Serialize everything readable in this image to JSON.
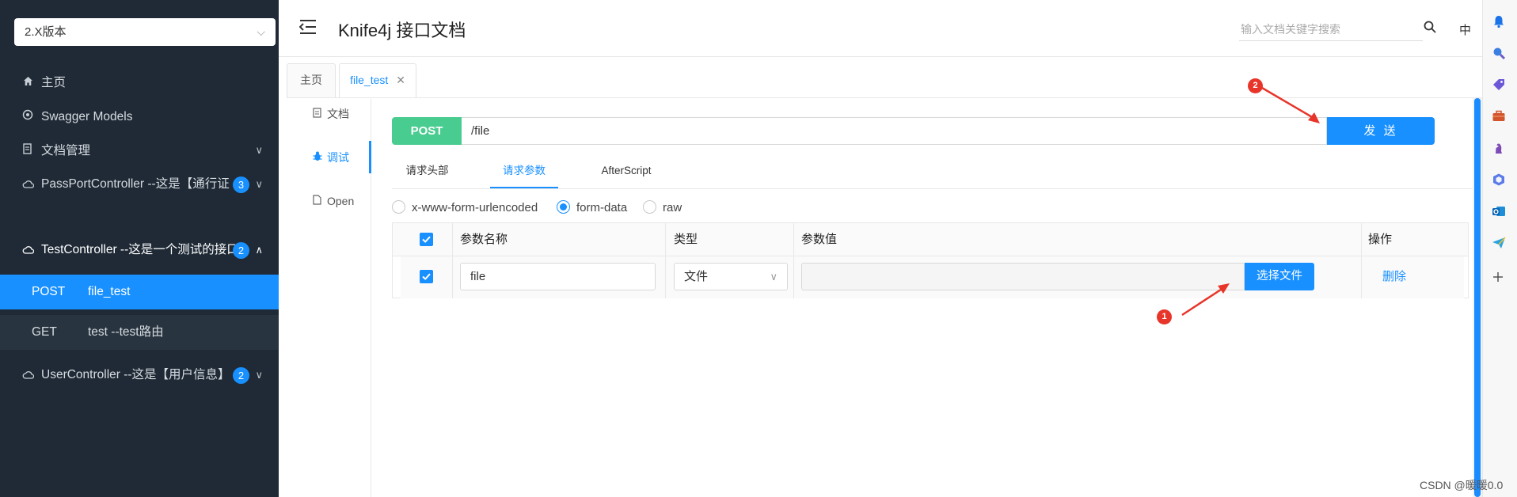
{
  "sidebar": {
    "version_select": "2.X版本",
    "items": [
      {
        "label": "主页",
        "icon": "home-icon"
      },
      {
        "label": "Swagger Models",
        "icon": "model-icon"
      },
      {
        "label": "文档管理",
        "icon": "doc-manage-icon"
      },
      {
        "label": "PassPortController --这是【通行证",
        "badge": "3",
        "icon": "cloud-icon"
      },
      {
        "label": "TestController --这是一个测试的接口",
        "badge": "2",
        "icon": "cloud-icon"
      },
      {
        "label": "UserController --这是【用户信息】",
        "badge": "2",
        "icon": "cloud-icon"
      }
    ],
    "sub_items": [
      {
        "method": "POST",
        "name": "file_test"
      },
      {
        "method": "GET",
        "name": "test --test路由"
      }
    ]
  },
  "header": {
    "title": "Knife4j 接口文档",
    "search_placeholder": "输入文档关键字搜索",
    "lang": "中"
  },
  "tabs": [
    {
      "label": "主页"
    },
    {
      "label": "file_test",
      "close": "✕"
    }
  ],
  "vnav": [
    {
      "label": "文档"
    },
    {
      "label": "调试"
    },
    {
      "label": "Open"
    }
  ],
  "request": {
    "method": "POST",
    "url": "/file",
    "send_label": "发 送"
  },
  "inner_tabs": [
    "请求头部",
    "请求参数",
    "AfterScript"
  ],
  "body_types": [
    {
      "label": "x-www-form-urlencoded",
      "checked": false
    },
    {
      "label": "form-data",
      "checked": true
    },
    {
      "label": "raw",
      "checked": false
    }
  ],
  "table": {
    "headers": [
      "参数名称",
      "类型",
      "参数值",
      "操作"
    ],
    "row": {
      "name": "file",
      "type": "文件",
      "choose_label": "选择文件",
      "delete_label": "删除"
    }
  },
  "annotations": [
    "1",
    "2"
  ],
  "watermark": "CSDN @暖暖0.0",
  "colors": {
    "sidebar_bg": "#1f2a36",
    "accent": "#1890ff",
    "post_green": "#49cc90",
    "annotation_red": "#e8352a"
  }
}
